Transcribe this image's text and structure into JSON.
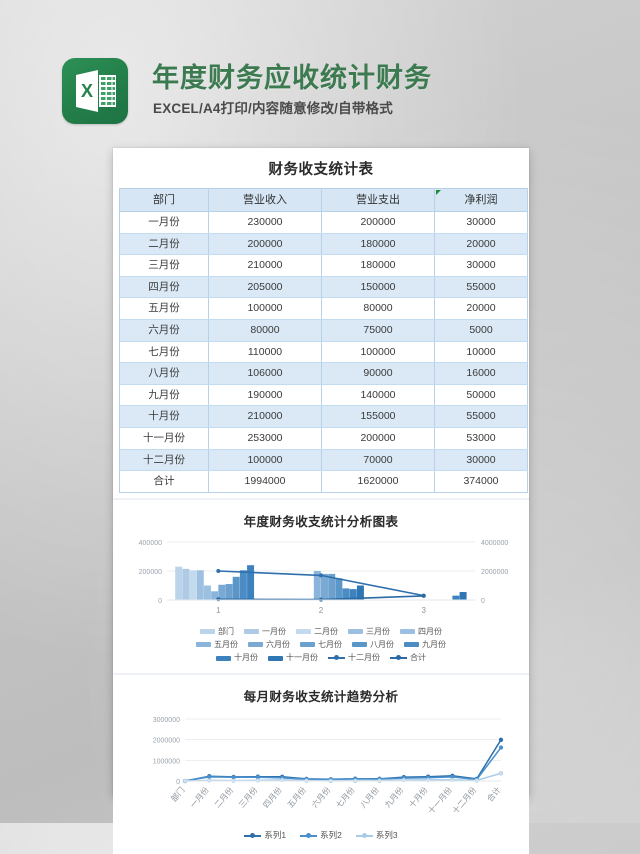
{
  "header": {
    "logo_icon": "excel-logo-icon",
    "title": "年度财务应收统计财务",
    "subtitle": "EXCEL/A4打印/内容随意修改/自带格式",
    "brand_green": "#3c7a50",
    "logo_green": "#24814b"
  },
  "sheet": {
    "table": {
      "title": "财务收支统计表",
      "columns": [
        "部门",
        "营业收入",
        "营业支出",
        "净利润"
      ],
      "has_comment_marker_on": "净利润",
      "rows": [
        [
          "一月份",
          "230000",
          "200000",
          "30000"
        ],
        [
          "二月份",
          "200000",
          "180000",
          "20000"
        ],
        [
          "三月份",
          "210000",
          "180000",
          "30000"
        ],
        [
          "四月份",
          "205000",
          "150000",
          "55000"
        ],
        [
          "五月份",
          "100000",
          "80000",
          "20000"
        ],
        [
          "六月份",
          "80000",
          "75000",
          "5000"
        ],
        [
          "七月份",
          "110000",
          "100000",
          "10000"
        ],
        [
          "八月份",
          "106000",
          "90000",
          "16000"
        ],
        [
          "九月份",
          "190000",
          "140000",
          "50000"
        ],
        [
          "十月份",
          "210000",
          "155000",
          "55000"
        ],
        [
          "十一月份",
          "253000",
          "200000",
          "53000"
        ],
        [
          "十二月份",
          "100000",
          "70000",
          "30000"
        ],
        [
          "合计",
          "1994000",
          "1620000",
          "374000"
        ]
      ]
    }
  },
  "chart_data": [
    {
      "type": "bar",
      "title": "年度财务收支统计分析图表",
      "xlabel": "",
      "ylabel": "",
      "categories": [
        "1",
        "2",
        "3"
      ],
      "ylim": [
        0,
        400000
      ],
      "yticks": [
        0,
        200000,
        400000
      ],
      "ytick_labels": [
        "0",
        "200000",
        "400000"
      ],
      "y2lim": [
        0,
        4000000
      ],
      "y2ticks": [
        0,
        2000000,
        4000000
      ],
      "y2tick_labels": [
        "0",
        "2000000",
        "4000000"
      ],
      "grid": true,
      "legend_position": "bottom",
      "series": [
        {
          "name": "部门",
          "kind": "bar",
          "color": "#bcd4ea",
          "values": [
            230000,
            0,
            0
          ]
        },
        {
          "name": "一月份",
          "kind": "bar",
          "color": "#aecae4",
          "values": [
            215000,
            0,
            0
          ]
        },
        {
          "name": "二月份",
          "kind": "bar",
          "color": "#c3d9ee",
          "values": [
            205000,
            0,
            0
          ]
        },
        {
          "name": "三月份",
          "kind": "bar",
          "color": "#9dc0e0",
          "values": [
            205000,
            0,
            0
          ]
        },
        {
          "name": "四月份",
          "kind": "bar",
          "color": "#9cc0e1",
          "values": [
            100000,
            0,
            0
          ]
        },
        {
          "name": "五月份",
          "kind": "bar",
          "color": "#8ab4da",
          "values": [
            60000,
            200000,
            0
          ]
        },
        {
          "name": "六月份",
          "kind": "bar",
          "color": "#7aa9d4",
          "values": [
            105000,
            180000,
            0
          ]
        },
        {
          "name": "七月份",
          "kind": "bar",
          "color": "#6ba0cf",
          "values": [
            110000,
            180000,
            0
          ]
        },
        {
          "name": "八月份",
          "kind": "bar",
          "color": "#5b96c9",
          "values": [
            160000,
            150000,
            0
          ]
        },
        {
          "name": "九月份",
          "kind": "bar",
          "color": "#4b8cc4",
          "values": [
            205000,
            80000,
            0
          ]
        },
        {
          "name": "十月份",
          "kind": "bar",
          "color": "#3b82be",
          "values": [
            240000,
            75000,
            30000
          ]
        },
        {
          "name": "十一月份",
          "kind": "bar",
          "color": "#2e77b4",
          "values": [
            0,
            100000,
            55000
          ]
        },
        {
          "name": "十二月份",
          "kind": "line",
          "color": "#2f6fab",
          "values": [
            200000,
            170000,
            30000
          ]
        },
        {
          "name": "合计",
          "kind": "line",
          "color": "#2b6aa5",
          "values": [
            5000,
            3000,
            28000
          ]
        }
      ]
    },
    {
      "type": "line",
      "title": "每月财务收支统计趋势分析",
      "xlabel": "",
      "ylabel": "",
      "categories": [
        "部门",
        "一月份",
        "二月份",
        "三月份",
        "四月份",
        "五月份",
        "六月份",
        "七月份",
        "八月份",
        "九月份",
        "十月份",
        "十一月份",
        "十二月份",
        "合计"
      ],
      "ylim": [
        0,
        3000000
      ],
      "yticks": [
        0,
        1000000,
        2000000,
        3000000
      ],
      "ytick_labels": [
        "0",
        "1000000",
        "2000000",
        "3000000"
      ],
      "grid": true,
      "legend_position": "bottom",
      "series": [
        {
          "name": "系列1",
          "color": "#2f6fab",
          "values": [
            0,
            230000,
            200000,
            210000,
            205000,
            100000,
            80000,
            110000,
            106000,
            190000,
            210000,
            253000,
            100000,
            1994000
          ]
        },
        {
          "name": "系列2",
          "color": "#4a90cc",
          "values": [
            0,
            200000,
            180000,
            180000,
            150000,
            80000,
            75000,
            100000,
            90000,
            140000,
            155000,
            200000,
            70000,
            1620000
          ]
        },
        {
          "name": "系列3",
          "color": "#a8cbe8",
          "values": [
            0,
            30000,
            20000,
            30000,
            55000,
            20000,
            5000,
            10000,
            16000,
            50000,
            55000,
            53000,
            30000,
            374000
          ]
        }
      ]
    }
  ]
}
